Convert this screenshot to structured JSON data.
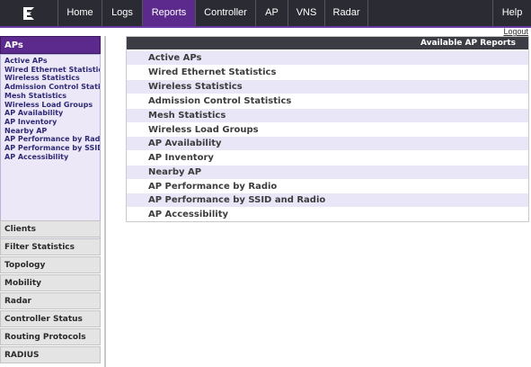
{
  "nav": {
    "tabs": [
      {
        "label": "Home"
      },
      {
        "label": "Logs"
      },
      {
        "label": "Reports"
      },
      {
        "label": "Controller"
      },
      {
        "label": "AP"
      },
      {
        "label": "VNS"
      },
      {
        "label": "Radar"
      },
      {
        "label": "Help"
      }
    ],
    "active_tab": "Reports",
    "logout_label": "Logout"
  },
  "sidebar": {
    "aps_title": "APs",
    "aps_links": [
      "Active APs",
      "Wired Ethernet Statistics",
      "Wireless Statistics",
      "Admission Control Statistics",
      "Mesh Statistics",
      "Wireless Load Groups",
      "AP Availability",
      "AP Inventory",
      "Nearby AP",
      "AP Performance by Radio",
      "AP Performance by SSID and Radio",
      "AP Accessibility"
    ],
    "sections": [
      "Clients",
      "Filter Statistics",
      "Topology",
      "Mobility",
      "Radar",
      "Controller Status",
      "Routing Protocols",
      "RADIUS"
    ]
  },
  "main": {
    "title": "Available AP Reports",
    "reports": [
      "Active APs",
      "Wired Ethernet Statistics",
      "Wireless Statistics",
      "Admission Control Statistics",
      "Mesh Statistics",
      "Wireless Load Groups",
      "AP Availability",
      "AP Inventory",
      "Nearby AP",
      "AP Performance by Radio",
      "AP Performance by SSID and Radio",
      "AP Accessibility"
    ]
  },
  "colors": {
    "nav_bg": "#2b2b33",
    "accent": "#5b2a8c",
    "row_alt": "#e9e6f8"
  },
  "icons": {
    "logo": "extreme-logo-icon"
  }
}
